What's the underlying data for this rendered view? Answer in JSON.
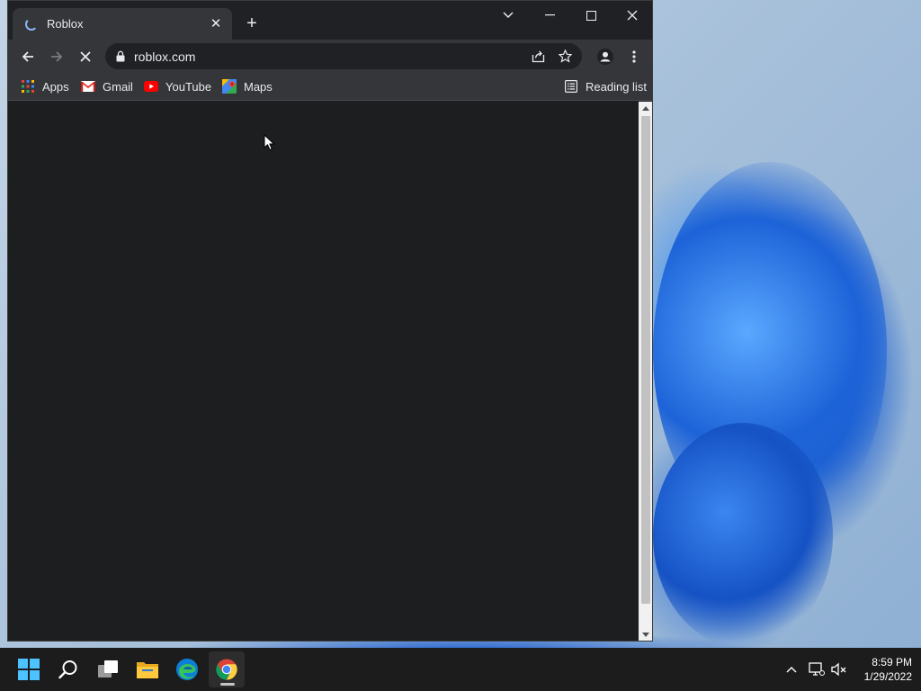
{
  "browser": {
    "tab": {
      "title": "Roblox",
      "close_glyph": "✕"
    },
    "new_tab_glyph": "+",
    "address": {
      "url": "roblox.com"
    },
    "bookmarks": [
      {
        "label": "Apps",
        "icon": "apps-grid-icon"
      },
      {
        "label": "Gmail",
        "icon": "gmail-icon"
      },
      {
        "label": "YouTube",
        "icon": "youtube-icon"
      },
      {
        "label": "Maps",
        "icon": "maps-icon"
      }
    ],
    "reading_list": "Reading list"
  },
  "taskbar": {
    "time": "8:59 PM",
    "date": "1/29/2022"
  },
  "colors": {
    "chrome_dark": "#202124",
    "toolbar": "#35363a",
    "page_bg": "#1d1e20",
    "accent_blue": "#8ab4f8",
    "taskbar": "#1c1c1c"
  }
}
